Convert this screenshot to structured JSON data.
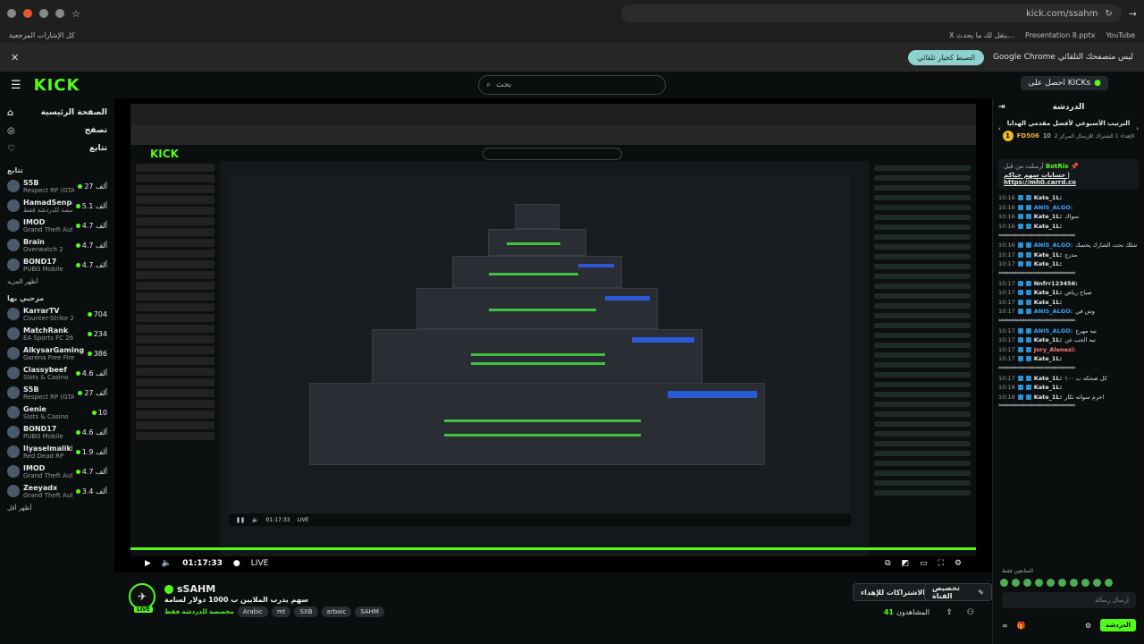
{
  "browser": {
    "url": "kick.com/ssahm",
    "bookmarks_left": "كل الإشارات المرجعية",
    "bookmarks_right": [
      "YouTube",
      "Presentation 8.pptx",
      "X ينقل لك ما يحدث..."
    ]
  },
  "infobar": {
    "message": "Google Chrome ليس متصفحك التلقائي",
    "button": "الضبط كخيار تلقائي"
  },
  "header": {
    "logo": "KICK",
    "search_placeholder": "بحث",
    "get_kicks": "احصل على KICKs"
  },
  "sidebar": {
    "nav": [
      {
        "label": "الصفحة الرئيسية",
        "icon": "home-icon"
      },
      {
        "label": "تصفح",
        "icon": "browse-icon"
      },
      {
        "label": "تتابع",
        "icon": "heart-icon"
      }
    ],
    "following_title": "تتابع",
    "following": [
      {
        "name": "S5B",
        "game": "Respect RP (GTA)",
        "viewers": "27 ألف"
      },
      {
        "name": "HamadSenpai",
        "game": "مخصصة للدردشة فقط",
        "viewers": "5.1 ألف"
      },
      {
        "name": "IMOD",
        "game": "Grand Theft Auto V...",
        "viewers": "4.7 ألف"
      },
      {
        "name": "Brain",
        "game": "Overwatch 2",
        "viewers": "4.7 ألف"
      },
      {
        "name": "BOND17",
        "game": "PUBG Mobile",
        "viewers": "4.7 ألف"
      }
    ],
    "show_more": "أظهر المزيد",
    "recommended_title": "مرحبي بها",
    "recommended": [
      {
        "name": "KarrarTV",
        "game": "Counter-Strike 2",
        "viewers": "704"
      },
      {
        "name": "MatchRank",
        "game": "EA Sports FC 26",
        "viewers": "234"
      },
      {
        "name": "AlkysarGaming",
        "game": "Garena Free Fire",
        "viewers": "386"
      },
      {
        "name": "Classybeef",
        "game": "Slots & Casino",
        "viewers": "4.6 ألف"
      },
      {
        "name": "S5B",
        "game": "Respect RP (GTA)",
        "viewers": "27 ألف"
      },
      {
        "name": "Genie",
        "game": "Slots & Casino",
        "viewers": "10"
      },
      {
        "name": "BOND17",
        "game": "PUBG Mobile",
        "viewers": "4.6 ألف"
      },
      {
        "name": "Ilyaselmaliki",
        "game": "Red Dead RP",
        "viewers": "1.9 ألف"
      },
      {
        "name": "IMOD",
        "game": "Grand Theft Auto V...",
        "viewers": "4.7 ألف"
      },
      {
        "name": "Zeeyadx",
        "game": "Grand Theft Auto V...",
        "viewers": "3.4 ألف"
      }
    ],
    "show_less": "أظهر أقل"
  },
  "player": {
    "time": "01:17:33",
    "live": "LIVE"
  },
  "stream": {
    "streamer": "sSAHM",
    "live_badge": "LIVE",
    "title": "سهم يدرب الملايين ب 1000 دولار لسامة",
    "category": "مخصصة للدردشة فقط",
    "tags": [
      "Arabic",
      "mt",
      "SXB",
      "arbaic",
      "SAHM"
    ],
    "subscribe_btn": "الاشتراكات للإهداء",
    "customize_btn": "تخصيص القناة",
    "viewers_count": "41",
    "viewers_label": "المشاهدون"
  },
  "chat": {
    "title": "الدردشة",
    "leaderboard_title": "الترتيب الأسبوعي لأفضل مقدمي الهدايا",
    "leaderboard_sub": "الإهداء 1 الشتراك للإرسال المركز 2",
    "top_gifter": "FD506",
    "top_gifter_count": "10",
    "pinned_user": "BotRix",
    "pinned_prefix": "أرسلت من قبل",
    "pinned_text": "حسابات سهم حياكم",
    "pinned_link": "https://mh0.carrd.co",
    "messages": [
      {
        "t": "10:16",
        "u": "Kate_1L:",
        "txt": "",
        "c": "#e8e8e8"
      },
      {
        "t": "10:16",
        "u": "ANIS_ALGO:",
        "txt": "",
        "c": "#3aa5ff"
      },
      {
        "t": "10:16",
        "u": "Kate_1L:",
        "txt": "سواك",
        "c": "#e8e8e8"
      },
      {
        "t": "10:16",
        "u": "Kate_1L:",
        "txt": "",
        "c": "#e8e8e8"
      },
      {
        "t": "",
        "u": "",
        "txt": "**************************************",
        "c": ""
      },
      {
        "t": "10:16",
        "u": "ANIS_ALGO:",
        "txt": "شلك تحت الشارك يحسك",
        "c": "#3aa5ff"
      },
      {
        "t": "10:17",
        "u": "Kate_1L:",
        "txt": "مدرج",
        "c": "#e8e8e8"
      },
      {
        "t": "10:17",
        "u": "Kate_1L:",
        "txt": "",
        "c": "#e8e8e8"
      },
      {
        "t": "",
        "u": "",
        "txt": "**************************************",
        "c": ""
      },
      {
        "t": "10:17",
        "u": "Nnfrr123456:",
        "txt": "",
        "c": "#e8e8e8"
      },
      {
        "t": "10:17",
        "u": "Kate_1L:",
        "txt": "صباح رياض",
        "c": "#e8e8e8"
      },
      {
        "t": "10:17",
        "u": "Kate_1L:",
        "txt": "",
        "c": "#e8e8e8"
      },
      {
        "t": "10:17",
        "u": "ANIS_ALGO:",
        "txt": "وش في",
        "c": "#3aa5ff"
      },
      {
        "t": "",
        "u": "",
        "txt": "**************************************",
        "c": ""
      },
      {
        "t": "10:17",
        "u": "ANIS_ALGO:",
        "txt": "تبه مهرج",
        "c": "#3aa5ff"
      },
      {
        "t": "10:17",
        "u": "Kate_1L:",
        "txt": "تبه الحب عن",
        "c": "#e8e8e8"
      },
      {
        "t": "10:17",
        "u": "Jory_Alenezi:",
        "txt": "",
        "c": "#ff7b7b"
      },
      {
        "t": "10:17",
        "u": "Kate_1L:",
        "txt": "",
        "c": "#e8e8e8"
      },
      {
        "t": "",
        "u": "",
        "txt": "**************************************",
        "c": ""
      },
      {
        "t": "10:17",
        "u": "Kate_1L:",
        "txt": "كل ضحكه ب ١٠٠",
        "c": "#e8e8e8"
      },
      {
        "t": "10:18",
        "u": "Kate_1L:",
        "txt": "",
        "c": "#e8e8e8"
      },
      {
        "t": "10:18",
        "u": "Kate_1L:",
        "txt": "احرم سواته تكار",
        "c": "#e8e8e8"
      },
      {
        "t": "",
        "u": "",
        "txt": "**************************************",
        "c": ""
      }
    ],
    "emotes_label": "المتابعين فقط",
    "input_placeholder": "إرسال رسالة",
    "send": "الدردشة"
  }
}
